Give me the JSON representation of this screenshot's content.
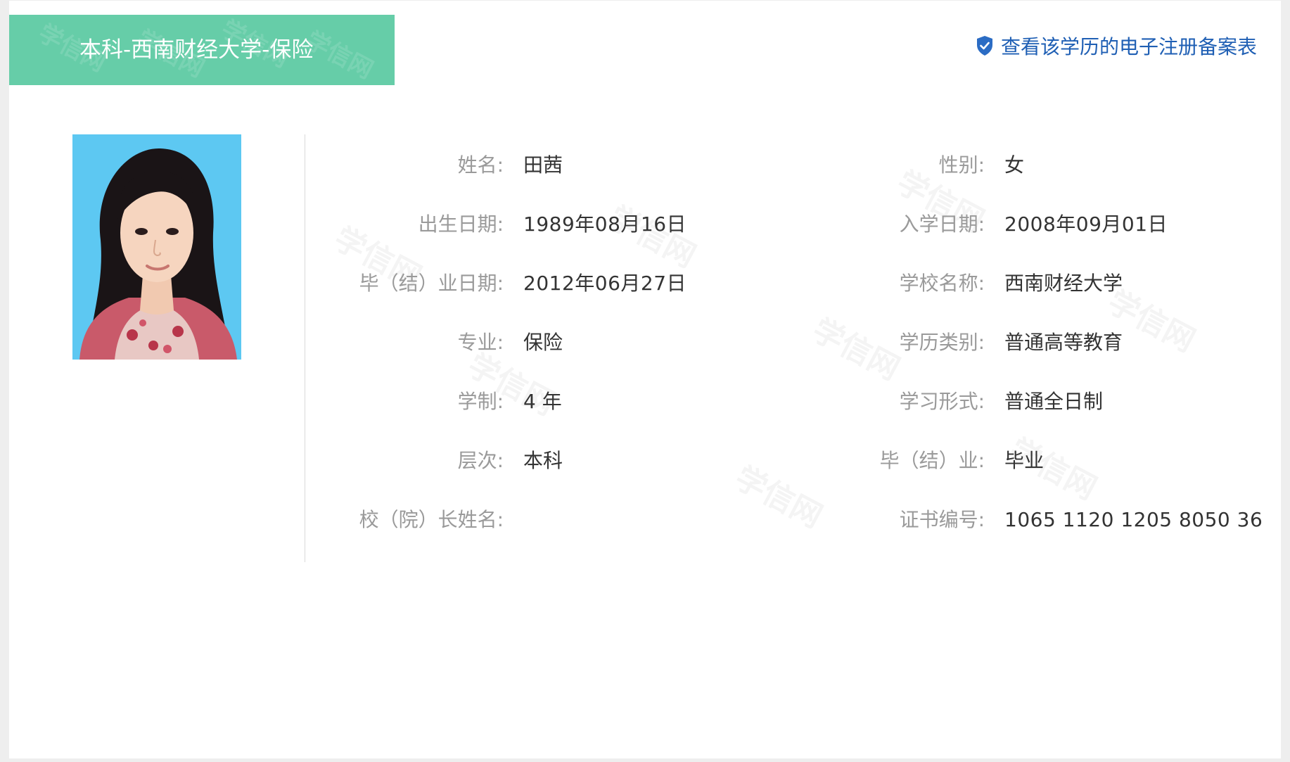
{
  "header": {
    "title": "本科-西南财经大学-保险",
    "watermark_text": "学信网",
    "background_color": "#66cda8"
  },
  "record_link": {
    "icon": "shield-check-icon",
    "label": "查看该学历的电子注册备案表",
    "color": "#1f5fb4"
  },
  "photo": {
    "icon": "student-photo",
    "background_color": "#5dc8f2"
  },
  "watermark_text": "学信网",
  "fields_left": [
    {
      "label": "姓名:",
      "value": "田茜"
    },
    {
      "label": "出生日期:",
      "value": "1989年08月16日"
    },
    {
      "label": "毕（结）业日期:",
      "value": "2012年06月27日"
    },
    {
      "label": "专业:",
      "value": "保险"
    },
    {
      "label": "学制:",
      "value": "4 年"
    },
    {
      "label": "层次:",
      "value": "本科"
    },
    {
      "label": "校（院）长姓名:",
      "value": ""
    }
  ],
  "fields_right": [
    {
      "label": "性别:",
      "value": "女"
    },
    {
      "label": "入学日期:",
      "value": "2008年09月01日"
    },
    {
      "label": "学校名称:",
      "value": "西南财经大学"
    },
    {
      "label": "学历类别:",
      "value": "普通高等教育"
    },
    {
      "label": "学习形式:",
      "value": "普通全日制"
    },
    {
      "label": "毕（结）业:",
      "value": "毕业"
    },
    {
      "label": "证书编号:",
      "value": "1065 1120 1205 8050 36"
    }
  ]
}
